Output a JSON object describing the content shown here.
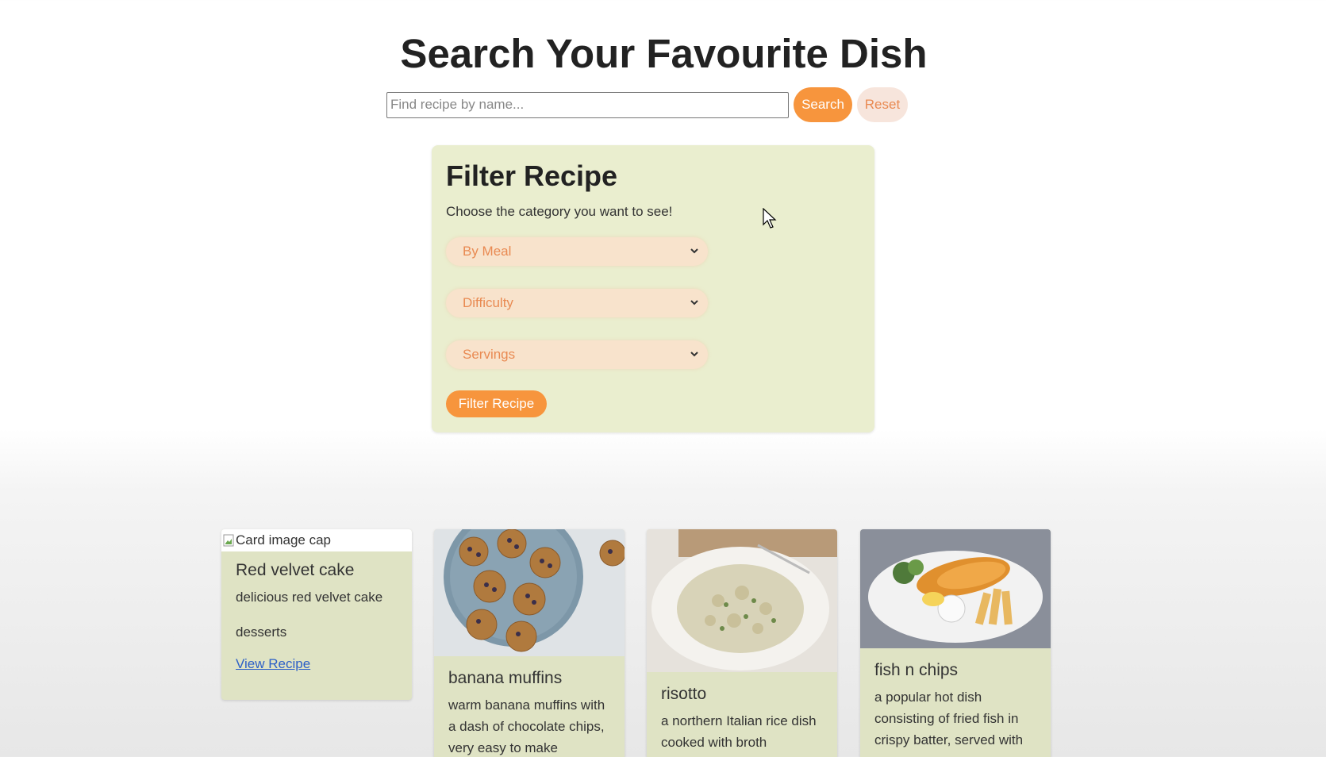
{
  "page": {
    "title": "Search Your Favourite Dish"
  },
  "search": {
    "placeholder": "Find recipe by name...",
    "value": "",
    "search_label": "Search",
    "reset_label": "Reset"
  },
  "filter": {
    "title": "Filter Recipe",
    "subtitle": "Choose the category you want to see!",
    "selects": [
      {
        "selected": "By Meal"
      },
      {
        "selected": "Difficulty"
      },
      {
        "selected": "Servings"
      }
    ],
    "button_label": "Filter Recipe"
  },
  "cards": [
    {
      "image_alt": "Card image cap",
      "title": "Red velvet cake",
      "description": "delicious red velvet cake",
      "category": "desserts",
      "link_label": "View Recipe"
    },
    {
      "title": "banana muffins",
      "description": "warm banana muffins with a dash of chocolate chips, very easy to make"
    },
    {
      "title": "risotto",
      "description": "a northern Italian rice dish cooked with broth"
    },
    {
      "title": "fish n chips",
      "description": "a popular hot dish consisting of fried fish in crispy batter, served with"
    }
  ],
  "colors": {
    "accent": "#f7953d",
    "reset_bg": "#f7e5dc",
    "panel_bg": "#eaeecf",
    "card_bg": "#dfe3c4",
    "select_bg": "#f8e3cc",
    "select_text": "#e98a52",
    "link": "#2b5fc7"
  }
}
